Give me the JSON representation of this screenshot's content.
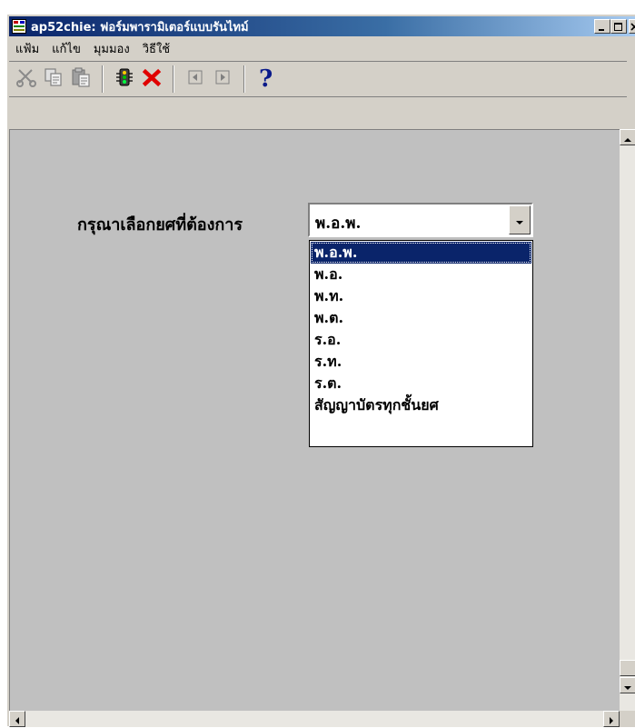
{
  "window": {
    "title": "ap52chie: ฟอร์มพารามิเตอร์แบบรันไทม์",
    "app_icon": "form-app-icon",
    "controls": [
      "minimize",
      "maximize",
      "close"
    ]
  },
  "menu": {
    "items": [
      "แฟ้ม",
      "แก้ไข",
      "มุมมอง",
      "วิธีใช้"
    ]
  },
  "toolbar": {
    "buttons": [
      "cut-icon",
      "copy-icon",
      "paste-icon",
      "run-icon",
      "cancel-icon",
      "prev-icon",
      "next-icon",
      "help-icon"
    ]
  },
  "form": {
    "prompt": "กรุณาเลือกยศที่ต้องการ",
    "selected_value": "พ.อ.พ.",
    "options": [
      "พ.อ.พ.",
      "พ.อ.",
      "พ.ท.",
      "พ.ต.",
      "ร.อ.",
      "ร.ท.",
      "ร.ต.",
      "สัญญาบัตรทุกชั้นยศ"
    ]
  },
  "colors": {
    "title_bar": "#0a246a",
    "selection": "#0a246a",
    "client_background": "#c0c0c0"
  }
}
